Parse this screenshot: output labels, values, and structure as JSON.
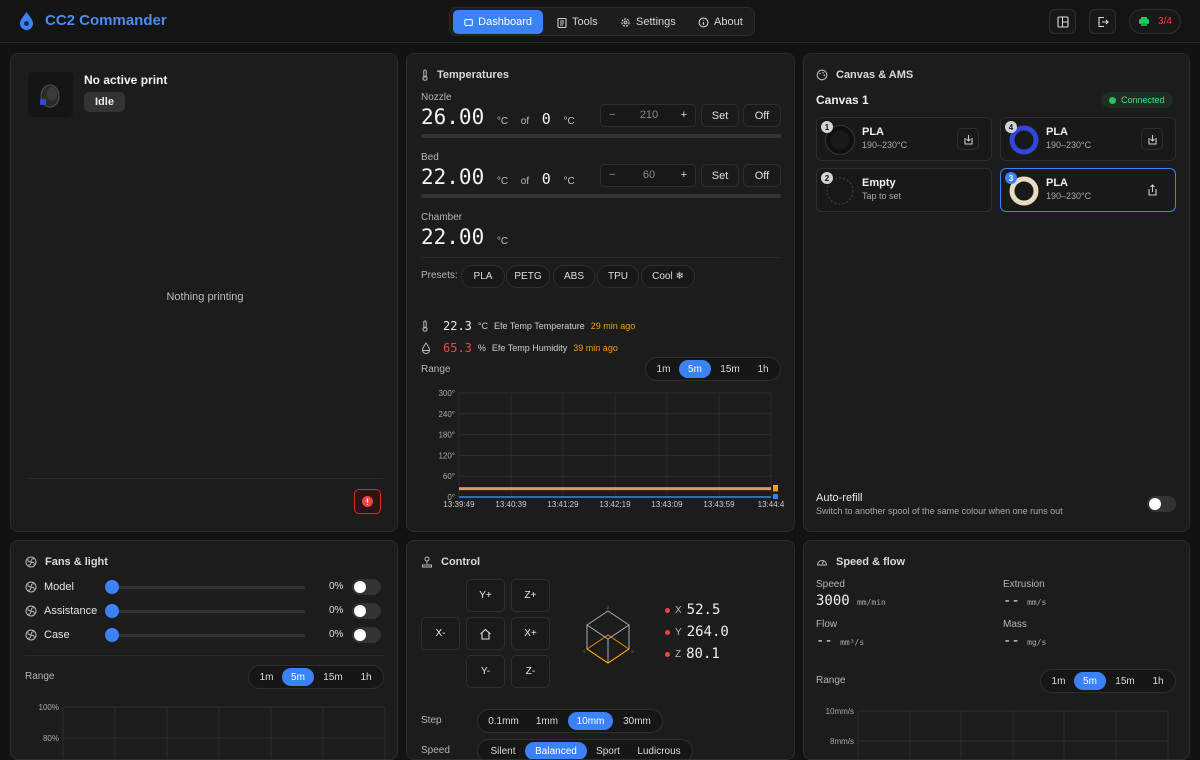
{
  "app": {
    "title": "CC2 Commander"
  },
  "nav": {
    "tabs": [
      {
        "label": "Dashboard"
      },
      {
        "label": "Tools"
      },
      {
        "label": "Settings"
      },
      {
        "label": "About"
      }
    ]
  },
  "header": {
    "printer_count": "3/4"
  },
  "print": {
    "status_title": "No active print",
    "state": "Idle",
    "empty_text": "Nothing printing"
  },
  "temps": {
    "title": "Temperatures",
    "nozzle": {
      "label": "Nozzle",
      "current": "26.00",
      "unit": "°C",
      "of": "of",
      "target": "0",
      "target_unit": "°C",
      "stepper_minus": "−",
      "stepper_value": "210",
      "stepper_plus": "+",
      "set": "Set",
      "off": "Off"
    },
    "bed": {
      "label": "Bed",
      "current": "22.00",
      "unit": "°C",
      "of": "of",
      "target": "0",
      "target_unit": "°C",
      "stepper_minus": "−",
      "stepper_value": "60",
      "stepper_plus": "+",
      "set": "Set",
      "off": "Off"
    },
    "chamber": {
      "label": "Chamber",
      "current": "22.00",
      "unit": "°C"
    },
    "presets_label": "Presets:",
    "presets": [
      "PLA",
      "PETG",
      "ABS",
      "TPU",
      "Cool ❄"
    ],
    "sensors": [
      {
        "value": "22.3",
        "unit": "°C",
        "name": "Efe Temp Temperature",
        "ago": "29 min ago"
      },
      {
        "value": "65.3",
        "unit": "%",
        "name": "Efe Temp Humidity",
        "ago": "39 min ago"
      }
    ],
    "range_label": "Range",
    "ranges": [
      "1m",
      "5m",
      "15m",
      "1h"
    ],
    "selected_range": "5m"
  },
  "chart_data": {
    "type": "line",
    "yticks": [
      "300°",
      "240°",
      "180°",
      "120°",
      "60°",
      "0°"
    ],
    "ylim": [
      0,
      300
    ],
    "xticks": [
      "13:39:49",
      "13:40:39",
      "13:41:29",
      "13:42:19",
      "13:43:09",
      "13:43:59",
      "13:44:4"
    ],
    "series": [
      {
        "color": "#f0a0a0",
        "values": [
          26,
          26,
          26,
          26,
          26,
          26,
          26
        ]
      },
      {
        "color": "#f59e0b",
        "values": [
          22,
          22,
          22,
          22,
          22,
          22,
          22
        ]
      },
      {
        "color": "#3b82f6",
        "values": [
          0,
          0,
          0,
          0,
          0,
          0,
          0
        ]
      }
    ],
    "grid": true
  },
  "ams": {
    "title": "Canvas & AMS",
    "unit_name": "Canvas 1",
    "status": "Connected",
    "slots": [
      {
        "num": "1",
        "name": "PLA",
        "range": "190–230°C",
        "color": "#111111"
      },
      {
        "num": "4",
        "name": "PLA",
        "range": "190–230°C",
        "color": "#2f49d6"
      },
      {
        "num": "2",
        "name": "Empty",
        "range": "Tap to set",
        "color": ""
      },
      {
        "num": "3",
        "name": "PLA",
        "range": "190–230°C",
        "color": "#e8dcc0"
      }
    ],
    "autorefill_title": "Auto-refill",
    "autorefill_desc": "Switch to another spool of the same colour when one runs out"
  },
  "fans": {
    "title": "Fans & light",
    "rows": [
      {
        "label": "Model",
        "value": "0%"
      },
      {
        "label": "Assistance",
        "value": "0%"
      },
      {
        "label": "Case",
        "value": "0%"
      }
    ],
    "range_label": "Range",
    "ranges": [
      "1m",
      "5m",
      "15m",
      "1h"
    ],
    "yticks": [
      "100%",
      "80%"
    ]
  },
  "control": {
    "title": "Control",
    "jog": {
      "yplus": "Y+",
      "zplus": "Z+",
      "xminus": "X-",
      "xplus": "X+",
      "yminus": "Y-",
      "zminus": "Z-"
    },
    "pos": [
      {
        "axis": "X",
        "value": "52.5"
      },
      {
        "axis": "Y",
        "value": "264.0"
      },
      {
        "axis": "Z",
        "value": "80.1"
      }
    ],
    "step_label": "Step",
    "steps": [
      "0.1mm",
      "1mm",
      "10mm",
      "30mm"
    ],
    "speed_label": "Speed",
    "speeds": [
      "Silent",
      "Balanced",
      "Sport",
      "Ludicrous"
    ]
  },
  "speed": {
    "title": "Speed & flow",
    "speed_label": "Speed",
    "speed_value": "3000",
    "speed_unit": "mm/min",
    "extrusion_label": "Extrusion",
    "extrusion_value": "--",
    "extrusion_unit": "mm/s",
    "flow_label": "Flow",
    "flow_value": "--",
    "flow_unit": "mm³/s",
    "mass_label": "Mass",
    "mass_value": "--",
    "mass_unit": "mg/s",
    "range_label": "Range",
    "ranges": [
      "1m",
      "5m",
      "15m",
      "1h"
    ],
    "yticks": [
      "10mm/s",
      "8mm/s"
    ]
  }
}
